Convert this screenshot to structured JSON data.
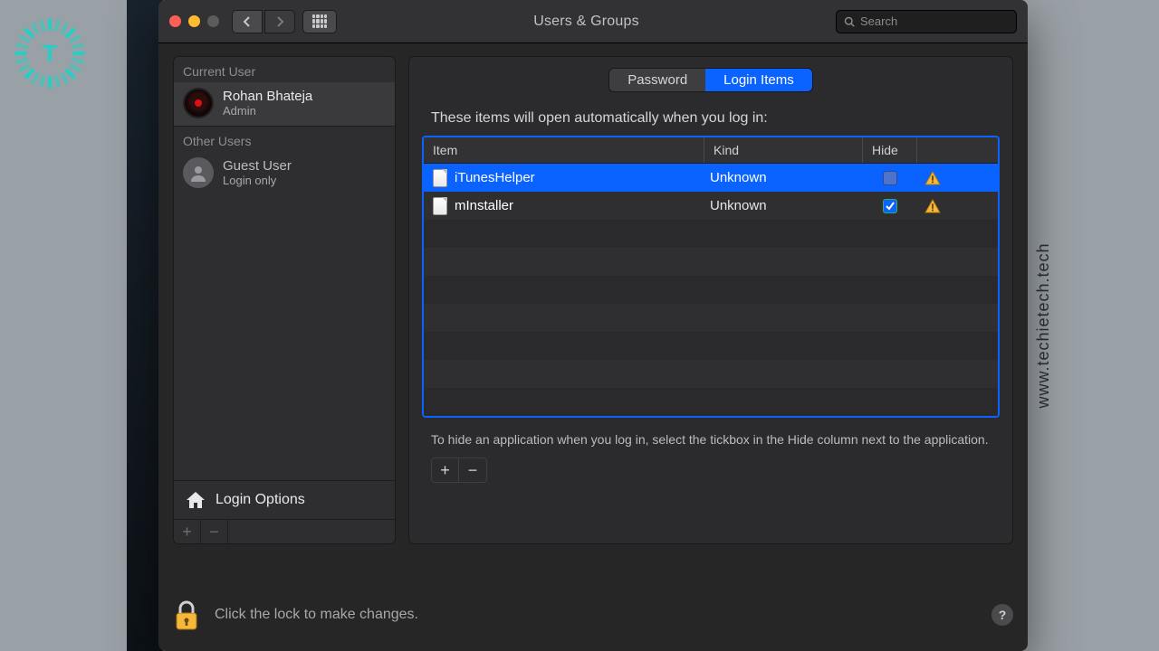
{
  "watermark": "www.techietech.tech",
  "logo_letter": "T",
  "window": {
    "title": "Users & Groups",
    "search_placeholder": "Search"
  },
  "sidebar": {
    "current_user_header": "Current User",
    "other_users_header": "Other Users",
    "current_user": {
      "name": "Rohan Bhateja",
      "role": "Admin"
    },
    "other_users": [
      {
        "name": "Guest User",
        "role": "Login only"
      }
    ],
    "login_options_label": "Login Options"
  },
  "tabs": {
    "password": "Password",
    "login_items": "Login Items",
    "selected": "login_items"
  },
  "content": {
    "description": "These items will open automatically when you log in:",
    "columns": {
      "item": "Item",
      "kind": "Kind",
      "hide": "Hide"
    },
    "rows": [
      {
        "item": "iTunesHelper",
        "kind": "Unknown",
        "hide": false,
        "warning": true,
        "selected": true
      },
      {
        "item": "mInstaller",
        "kind": "Unknown",
        "hide": true,
        "warning": true,
        "selected": false
      }
    ],
    "hint": "To hide an application when you log in, select the tickbox in the Hide column next to the application."
  },
  "lockbar": {
    "text": "Click the lock to make changes."
  }
}
